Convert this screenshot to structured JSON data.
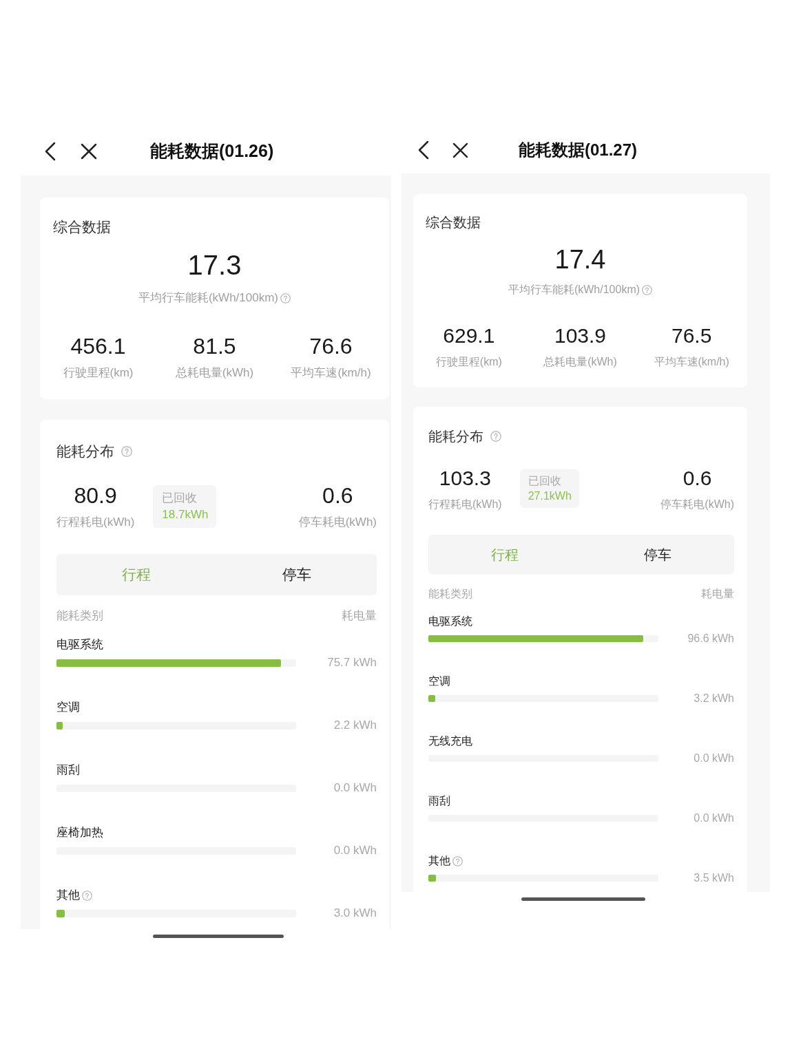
{
  "screens": [
    {
      "header": {
        "title": "能耗数据(01.26)"
      },
      "summary": {
        "title": "综合数据",
        "value": "17.3",
        "label": "平均行车能耗(kWh/100km)",
        "stats": [
          {
            "value": "456.1",
            "label": "行驶里程(km)"
          },
          {
            "value": "81.5",
            "label": "总耗电量(kWh)"
          },
          {
            "value": "76.6",
            "label": "平均车速(km/h)"
          }
        ]
      },
      "distribution": {
        "title": "能耗分布",
        "trip": {
          "value": "80.9",
          "label": "行程耗电(kWh)"
        },
        "recovered": {
          "label": "已回收",
          "value": "18.7kWh"
        },
        "parking": {
          "value": "0.6",
          "label": "停车耗电(kWh)"
        },
        "tabs": [
          {
            "label": "行程",
            "selected": true
          },
          {
            "label": "停车",
            "selected": false
          }
        ],
        "columns": [
          "能耗类别",
          "耗电量"
        ],
        "items": [
          {
            "name": "电驱系统",
            "help": false,
            "level": 0.937,
            "reading": "75.7 kWh"
          },
          {
            "name": "空调",
            "help": false,
            "level": 0.027,
            "reading": "2.2 kWh"
          },
          {
            "name": "雨刮",
            "help": false,
            "level": 0,
            "reading": "0.0 kWh"
          },
          {
            "name": "座椅加热",
            "help": false,
            "level": 0,
            "reading": "0.0 kWh"
          },
          {
            "name": "其他",
            "help": true,
            "level": 0.035,
            "reading": "3.0 kWh"
          }
        ]
      }
    },
    {
      "header": {
        "title": "能耗数据(01.27)"
      },
      "summary": {
        "title": "综合数据",
        "value": "17.4",
        "label": "平均行车能耗(kWh/100km)",
        "stats": [
          {
            "value": "629.1",
            "label": "行驶里程(km)"
          },
          {
            "value": "103.9",
            "label": "总耗电量(kWh)"
          },
          {
            "value": "76.5",
            "label": "平均车速(km/h)"
          }
        ]
      },
      "distribution": {
        "title": "能耗分布",
        "trip": {
          "value": "103.3",
          "label": "行程耗电(kWh)"
        },
        "recovered": {
          "label": "已回收",
          "value": "27.1kWh"
        },
        "parking": {
          "value": "0.6",
          "label": "停车耗电(kWh)"
        },
        "tabs": [
          {
            "label": "行程",
            "selected": true
          },
          {
            "label": "停车",
            "selected": false
          }
        ],
        "columns": [
          "能耗类别",
          "耗电量"
        ],
        "items": [
          {
            "name": "电驱系统",
            "help": false,
            "level": 0.935,
            "reading": "96.6 kWh"
          },
          {
            "name": "空调",
            "help": false,
            "level": 0.031,
            "reading": "3.2 kWh"
          },
          {
            "name": "无线充电",
            "help": false,
            "level": 0,
            "reading": "0.0 kWh"
          },
          {
            "name": "雨刮",
            "help": false,
            "level": 0,
            "reading": "0.0 kWh"
          },
          {
            "name": "其他",
            "help": true,
            "level": 0.034,
            "reading": "3.5 kWh"
          }
        ]
      }
    }
  ]
}
